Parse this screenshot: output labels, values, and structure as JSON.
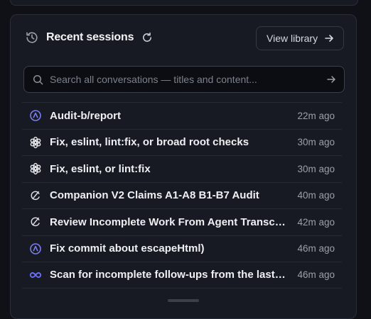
{
  "header": {
    "title": "Recent sessions",
    "view_library_label": "View library"
  },
  "search": {
    "placeholder": "Search all conversations — titles and content..."
  },
  "sessions": [
    {
      "icon": "agent-icon",
      "title": "Audit-b/report",
      "time": "22m ago"
    },
    {
      "icon": "openai-icon",
      "title": "Fix, eslint, lint:fix, or broad root checks",
      "time": "30m ago"
    },
    {
      "icon": "openai-icon",
      "title": "Fix, eslint, or lint:fix",
      "time": "30m ago"
    },
    {
      "icon": "cursor-icon",
      "title": "Companion V2 Claims A1-A8 B1-B7 Audit",
      "time": "40m ago"
    },
    {
      "icon": "cursor-icon",
      "title": "Review Incomplete Work From Agent Transcripts",
      "time": "42m ago"
    },
    {
      "icon": "agent-icon",
      "title": "Fix commit about escapeHtml)",
      "time": "46m ago"
    },
    {
      "icon": "infinity-icon",
      "title": "Scan for incomplete follow-ups from the last session",
      "time": "46m ago"
    }
  ],
  "colors": {
    "background": "#0f1117",
    "card": "#171a22",
    "accent_agent": "#7b7ef0",
    "accent_infinity": "#6b6ff5",
    "text_primary": "#eef0f3",
    "text_secondary": "#9aa0aa"
  }
}
